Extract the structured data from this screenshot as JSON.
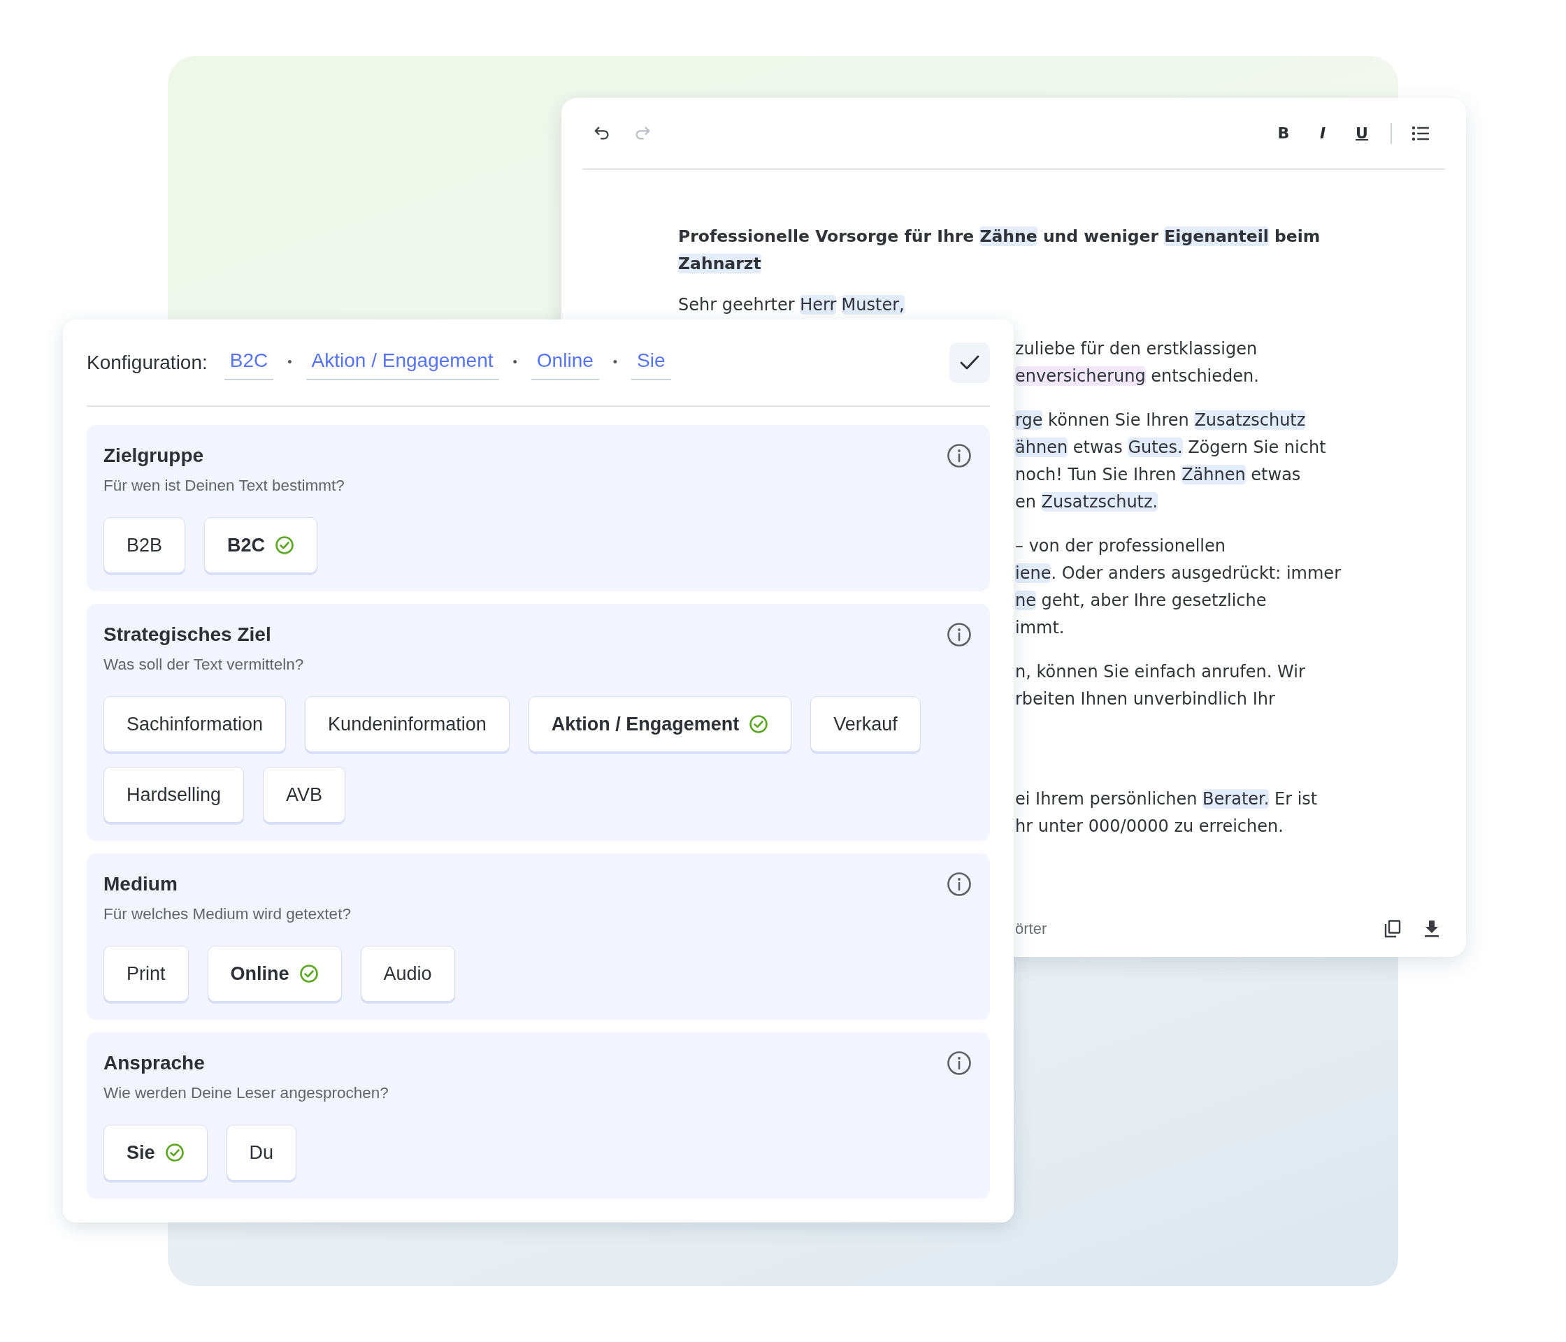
{
  "editor": {
    "history": [
      {
        "kind": "undo",
        "disabled": false
      },
      {
        "kind": "redo",
        "disabled": true
      }
    ],
    "format_buttons": [
      {
        "kind": "bold",
        "label": "B"
      },
      {
        "kind": "italic",
        "label": "I"
      },
      {
        "kind": "underline",
        "label": "U"
      }
    ],
    "heading": [
      [
        {
          "text": "Professionelle Vorsorge für Ihre ",
          "highlighted": false
        },
        {
          "text": "Zähne",
          "highlighted": true,
          "color": "#e2ecfb"
        },
        {
          "text": " und weniger ",
          "highlighted": false
        },
        {
          "text": "Eigenanteil",
          "highlighted": true,
          "color": "#e2ecfb"
        },
        {
          "text": " beim",
          "highlighted": false
        }
      ],
      [
        {
          "text": "Zahnarzt",
          "highlighted": true,
          "color": "#e2ecfb"
        }
      ]
    ],
    "greeting": [
      {
        "text": "Sehr geehrter ",
        "highlighted": false
      },
      {
        "text": "Herr",
        "highlighted": true,
        "color": "#e2ecfb"
      },
      {
        "text": "Muster,",
        "highlighted": true,
        "color": "#e2ecfb"
      }
    ],
    "paragraphs": [
      [
        [
          {
            "text": "zuliebe für den erstklassigen",
            "highlighted": false
          }
        ],
        [
          {
            "text": "enversicherung",
            "highlighted": true,
            "color": "#f1e9fb"
          },
          {
            "text": " entschieden.",
            "highlighted": false
          }
        ]
      ],
      [
        [
          {
            "text": "rge",
            "highlighted": true,
            "color": "#e2ecfb"
          },
          {
            "text": " können Sie Ihren ",
            "highlighted": false
          },
          {
            "text": "Zusatzschutz",
            "highlighted": true,
            "color": "#e2ecfb"
          }
        ],
        [
          {
            "text": "ähnen",
            "highlighted": true,
            "color": "#e2ecfb"
          },
          {
            "text": " etwas ",
            "highlighted": false
          },
          {
            "text": "Gutes.",
            "highlighted": true,
            "color": "#e2ecfb"
          },
          {
            "text": " Zögern Sie nicht",
            "highlighted": false
          }
        ],
        [
          {
            "text": "noch! Tun Sie Ihren ",
            "highlighted": false
          },
          {
            "text": "Zähnen",
            "highlighted": true,
            "color": "#e2ecfb"
          },
          {
            "text": " etwas",
            "highlighted": false
          }
        ],
        [
          {
            "text": "en ",
            "highlighted": false
          },
          {
            "text": "Zusatzschutz.",
            "highlighted": true,
            "color": "#e2ecfb"
          }
        ]
      ],
      [
        [
          {
            "text": "– von der professionellen",
            "highlighted": false
          }
        ],
        [
          {
            "text": "iene",
            "highlighted": true,
            "color": "#e2ecfb"
          },
          {
            "text": ". Oder anders ausgedrückt: immer",
            "highlighted": false
          }
        ],
        [
          {
            "text": "ne",
            "highlighted": true,
            "color": "#e2ecfb"
          },
          {
            "text": " geht, aber Ihre gesetzliche",
            "highlighted": false
          }
        ],
        [
          {
            "text": "immt.",
            "highlighted": false
          }
        ]
      ],
      [
        [
          {
            "text": "n, können Sie einfach anrufen. Wir",
            "highlighted": false
          }
        ],
        [
          {
            "text": "rbeiten Ihnen unverbindlich Ihr",
            "highlighted": false
          }
        ]
      ],
      [
        [
          {
            "text": "ei Ihrem persönlichen ",
            "highlighted": false
          },
          {
            "text": "Berater.",
            "highlighted": true,
            "color": "#e2ecfb"
          },
          {
            "text": " Er ist",
            "highlighted": false
          }
        ],
        [
          {
            "text": "hr unter 000/0000 zu erreichen.",
            "highlighted": false
          }
        ]
      ]
    ],
    "footer": {
      "word_count": "örter"
    }
  },
  "configuration": {
    "label": "Konfiguration:",
    "summary": [
      {
        "kind": "value",
        "text": "B2C"
      },
      {
        "kind": "separator",
        "text": "•"
      },
      {
        "kind": "value",
        "text": "Aktion / Engagement"
      },
      {
        "kind": "separator",
        "text": "•"
      },
      {
        "kind": "value",
        "text": "Online"
      },
      {
        "kind": "separator",
        "text": "•"
      },
      {
        "kind": "value",
        "text": "Sie"
      }
    ],
    "sections": [
      {
        "title": "Zielgruppe",
        "question": "Für wen ist Deinen Text bestimmt?",
        "options": [
          {
            "label": "B2B",
            "selected": false
          },
          {
            "label": "B2C",
            "selected": true
          }
        ]
      },
      {
        "title": "Strategisches Ziel",
        "question": "Was soll der Text vermitteln?",
        "options": [
          {
            "label": "Sachinformation",
            "selected": false
          },
          {
            "label": "Kundeninformation",
            "selected": false
          },
          {
            "label": "Aktion / Engagement",
            "selected": true
          },
          {
            "label": "Verkauf",
            "selected": false
          },
          {
            "label": "Hardselling",
            "selected": false
          },
          {
            "label": "AVB",
            "selected": false
          }
        ]
      },
      {
        "title": "Medium",
        "question": "Für welches Medium wird getextet?",
        "options": [
          {
            "label": "Print",
            "selected": false
          },
          {
            "label": "Online",
            "selected": true
          },
          {
            "label": "Audio",
            "selected": false
          }
        ]
      },
      {
        "title": "Ansprache",
        "question": "Wie werden Deine Leser angesprochen?",
        "options": [
          {
            "label": "Sie",
            "selected": true
          },
          {
            "label": "Du",
            "selected": false
          }
        ]
      }
    ]
  }
}
